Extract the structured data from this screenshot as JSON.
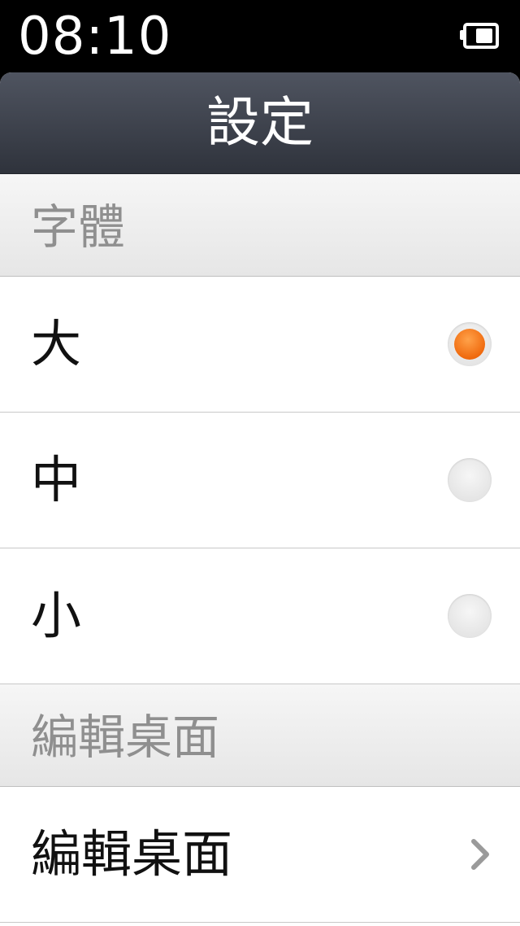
{
  "status_bar": {
    "time": "08:10",
    "battery_icon": "battery-icon"
  },
  "header": {
    "title": "設定"
  },
  "sections": [
    {
      "header": "字體",
      "options": [
        {
          "label": "大",
          "selected": true
        },
        {
          "label": "中",
          "selected": false
        },
        {
          "label": "小",
          "selected": false
        }
      ]
    },
    {
      "header": "編輯桌面",
      "items": [
        {
          "label": "編輯桌面",
          "icon": "chevron-right-icon"
        }
      ]
    }
  ],
  "colors": {
    "accent": "#f06a0e",
    "title_bar": "#3a3e47",
    "section_text": "#8f8f8f"
  }
}
